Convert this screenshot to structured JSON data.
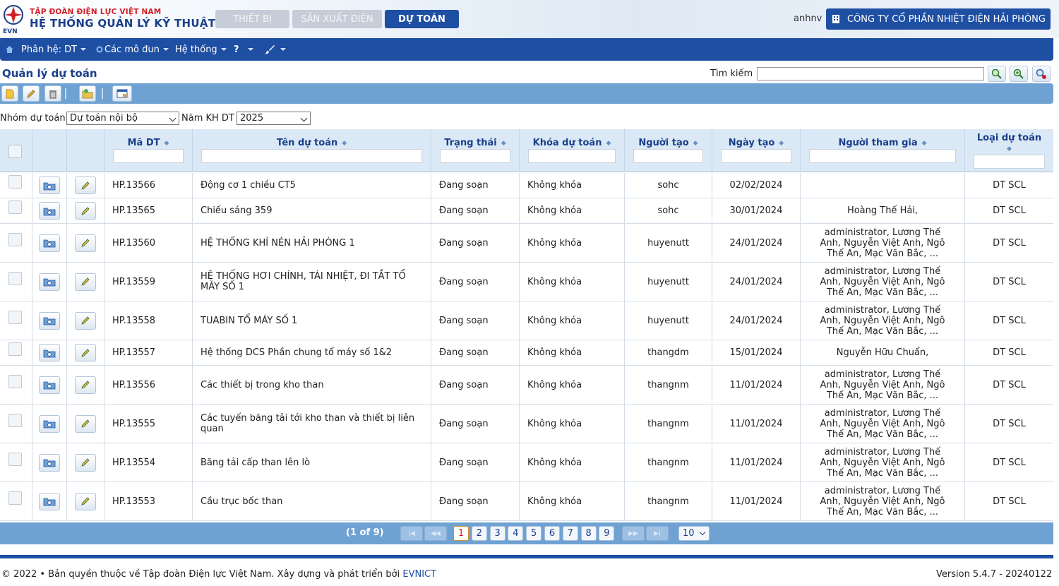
{
  "header": {
    "corp_name": "TẬP ĐOÀN ĐIỆN LỰC VIỆT NAM",
    "system_name": "HỆ THỐNG QUẢN LÝ KỸ THUẬT",
    "logo_text": "EVN",
    "tabs": [
      {
        "label": "THIẾT BỊ",
        "active": false
      },
      {
        "label": "SẢN XUẤT ĐIỆN",
        "active": false
      },
      {
        "label": "DỰ TOÁN",
        "active": true
      }
    ],
    "username": "anhnv",
    "company": "CÔNG TY CỔ PHẦN NHIỆT ĐIỆN HẢI PHÒNG"
  },
  "menu": {
    "subsystem": "Phân hệ: DT",
    "modules": "Các mô đun",
    "system": "Hệ thống",
    "help": "?"
  },
  "page": {
    "title": "Quản lý dự toán",
    "search_label": "Tìm kiếm",
    "search_value": ""
  },
  "filters": {
    "group_label": "Nhóm dự toán",
    "group_value": "Dự toán nội bộ",
    "year_label": "Năm KH DT",
    "year_value": "2025"
  },
  "table": {
    "columns": [
      "Mã DT",
      "Tên dự toán",
      "Trạng thái",
      "Khóa dự toán",
      "Người tạo",
      "Ngày tạo",
      "Người tham gia",
      "Loại dự toán"
    ],
    "rows": [
      {
        "code": "HP.13566",
        "name": "Động cơ 1 chiều CT5",
        "status": "Đang soạn",
        "lock": "Không khóa",
        "creator": "sohc",
        "date": "02/02/2024",
        "participants": "",
        "type": "DT SCL"
      },
      {
        "code": "HP.13565",
        "name": "Chiếu sáng 359",
        "status": "Đang soạn",
        "lock": "Không khóa",
        "creator": "sohc",
        "date": "30/01/2024",
        "participants": "Hoàng Thế Hải,",
        "type": "DT SCL"
      },
      {
        "code": "HP.13560",
        "name": "HỆ THỐNG KHÍ NÉN HẢI PHÒNG 1",
        "status": "Đang soạn",
        "lock": "Không khóa",
        "creator": "huyenutt",
        "date": "24/01/2024",
        "participants": "administrator, Lương Thế Anh, Nguyễn Việt Anh, Ngô Thế An, Mạc Văn Bắc, ...",
        "type": "DT SCL"
      },
      {
        "code": "HP.13559",
        "name": "HỆ THỐNG HƠI CHÍNH, TÁI NHIỆT, ĐI TẮT TỔ MÁY SỐ 1",
        "status": "Đang soạn",
        "lock": "Không khóa",
        "creator": "huyenutt",
        "date": "24/01/2024",
        "participants": "administrator, Lương Thế Anh, Nguyễn Việt Anh, Ngô Thế An, Mạc Văn Bắc, ...",
        "type": "DT SCL"
      },
      {
        "code": "HP.13558",
        "name": "TUABIN TỔ MÁY SỐ 1",
        "status": "Đang soạn",
        "lock": "Không khóa",
        "creator": "huyenutt",
        "date": "24/01/2024",
        "participants": "administrator, Lương Thế Anh, Nguyễn Việt Anh, Ngô Thế An, Mạc Văn Bắc, ...",
        "type": "DT SCL"
      },
      {
        "code": "HP.13557",
        "name": "Hệ thống DCS Phần chung tổ máy số 1&2",
        "status": "Đang soạn",
        "lock": "Không khóa",
        "creator": "thangdm",
        "date": "15/01/2024",
        "participants": "Nguyễn Hữu Chuẩn,",
        "type": "DT SCL"
      },
      {
        "code": "HP.13556",
        "name": "Các thiết bị trong kho than",
        "status": "Đang soạn",
        "lock": "Không khóa",
        "creator": "thangnm",
        "date": "11/01/2024",
        "participants": "administrator, Lương Thế Anh, Nguyễn Việt Anh, Ngô Thế An, Mạc Văn Bắc, ...",
        "type": "DT SCL"
      },
      {
        "code": "HP.13555",
        "name": "Các tuyến băng tải tới kho than và thiết bị liên quan",
        "status": "Đang soạn",
        "lock": "Không khóa",
        "creator": "thangnm",
        "date": "11/01/2024",
        "participants": "administrator, Lương Thế Anh, Nguyễn Việt Anh, Ngô Thế An, Mạc Văn Bắc, ...",
        "type": "DT SCL"
      },
      {
        "code": "HP.13554",
        "name": "Băng tải cấp than lên lò",
        "status": "Đang soạn",
        "lock": "Không khóa",
        "creator": "thangnm",
        "date": "11/01/2024",
        "participants": "administrator, Lương Thế Anh, Nguyễn Việt Anh, Ngô Thế An, Mạc Văn Bắc, ...",
        "type": "DT SCL"
      },
      {
        "code": "HP.13553",
        "name": "Cầu trục bốc than",
        "status": "Đang soạn",
        "lock": "Không khóa",
        "creator": "thangnm",
        "date": "11/01/2024",
        "participants": "administrator, Lương Thế Anh, Nguyễn Việt Anh, Ngô Thế An, Mạc Văn Bắc, ...",
        "type": "DT SCL"
      }
    ]
  },
  "paginator": {
    "info": "(1 of 9)",
    "pages": [
      "1",
      "2",
      "3",
      "4",
      "5",
      "6",
      "7",
      "8",
      "9"
    ],
    "current": "1",
    "rows_per_page": "10"
  },
  "footer": {
    "copyright": "©  2022  •  Bản quyền thuộc về Tập đoàn Điện lực Việt Nam. Xây dựng và phát triển bởi",
    "developer": "EVNICT",
    "version": "Version 5.4.7 - 20240122"
  },
  "colors": {
    "brand_blue": "#1e4fa3",
    "bar_blue": "#6fa2d3",
    "brand_red": "#d0202a"
  }
}
